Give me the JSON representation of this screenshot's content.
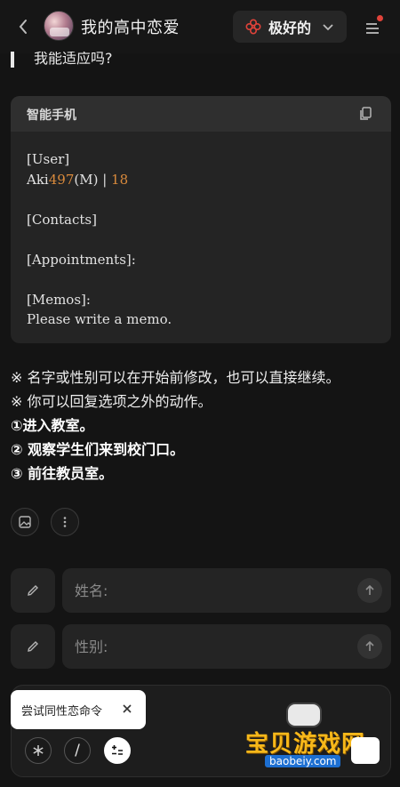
{
  "header": {
    "title": "我的高中恋爱",
    "mode_label": "极好的",
    "accent": "#e0433a"
  },
  "partial_text": "我能适应吗?",
  "phone_card": {
    "title": "智能手机",
    "user_header": "[User]",
    "user_name": "Aki",
    "user_id": "497",
    "user_gender": "(M) |",
    "user_age": "18",
    "contacts": "[Contacts]",
    "appointments": "[Appointments]:",
    "memos": "[Memos]:",
    "memo_text": "Please write a memo."
  },
  "message": {
    "note1": "※ 名字或性别可以在开始前修改，也可以直接继续。",
    "note2": "※ 你可以回复选项之外的动作。",
    "option1": "①进入教室。",
    "option2": "② 观察学生们来到校门口。",
    "option3": "③ 前往教员室。"
  },
  "inputs": {
    "name_placeholder": "姓名:",
    "gender_placeholder": "性别:"
  },
  "composer": {
    "tooltip": "尝试同性恋命令",
    "tool_slash": "/"
  },
  "watermark": {
    "text": "宝贝游戏网",
    "url": "baobeiy.com"
  },
  "icons": [
    "back-icon",
    "flower-icon",
    "chevron-down-icon",
    "menu-icon",
    "copy-icon",
    "image-icon",
    "more-icon",
    "pencil-icon",
    "arrow-up-icon",
    "close-icon",
    "asterisk-icon",
    "slash-icon",
    "plus-minus-icon"
  ]
}
